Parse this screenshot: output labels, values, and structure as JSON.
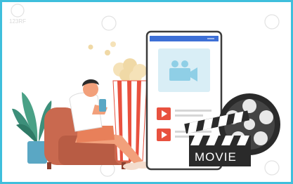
{
  "image": {
    "title": "",
    "clapperboard_text": "MOVIE",
    "watermark": "123RF",
    "colors": {
      "border": "#3fbfdc",
      "phone_screen_accent": "#8fcfe6",
      "play_button": "#e8513f",
      "couch": "#c9694f",
      "popcorn_stripe": "#e8513f",
      "plant": "#3d8f7a",
      "pot": "#5aa7c4",
      "reel": "#2a2a2a"
    },
    "icons": [
      "video-camera-icon",
      "play-icon",
      "play-icon",
      "film-reel-icon",
      "clapperboard-icon",
      "popcorn-icon",
      "plant-icon",
      "couch-icon"
    ]
  }
}
